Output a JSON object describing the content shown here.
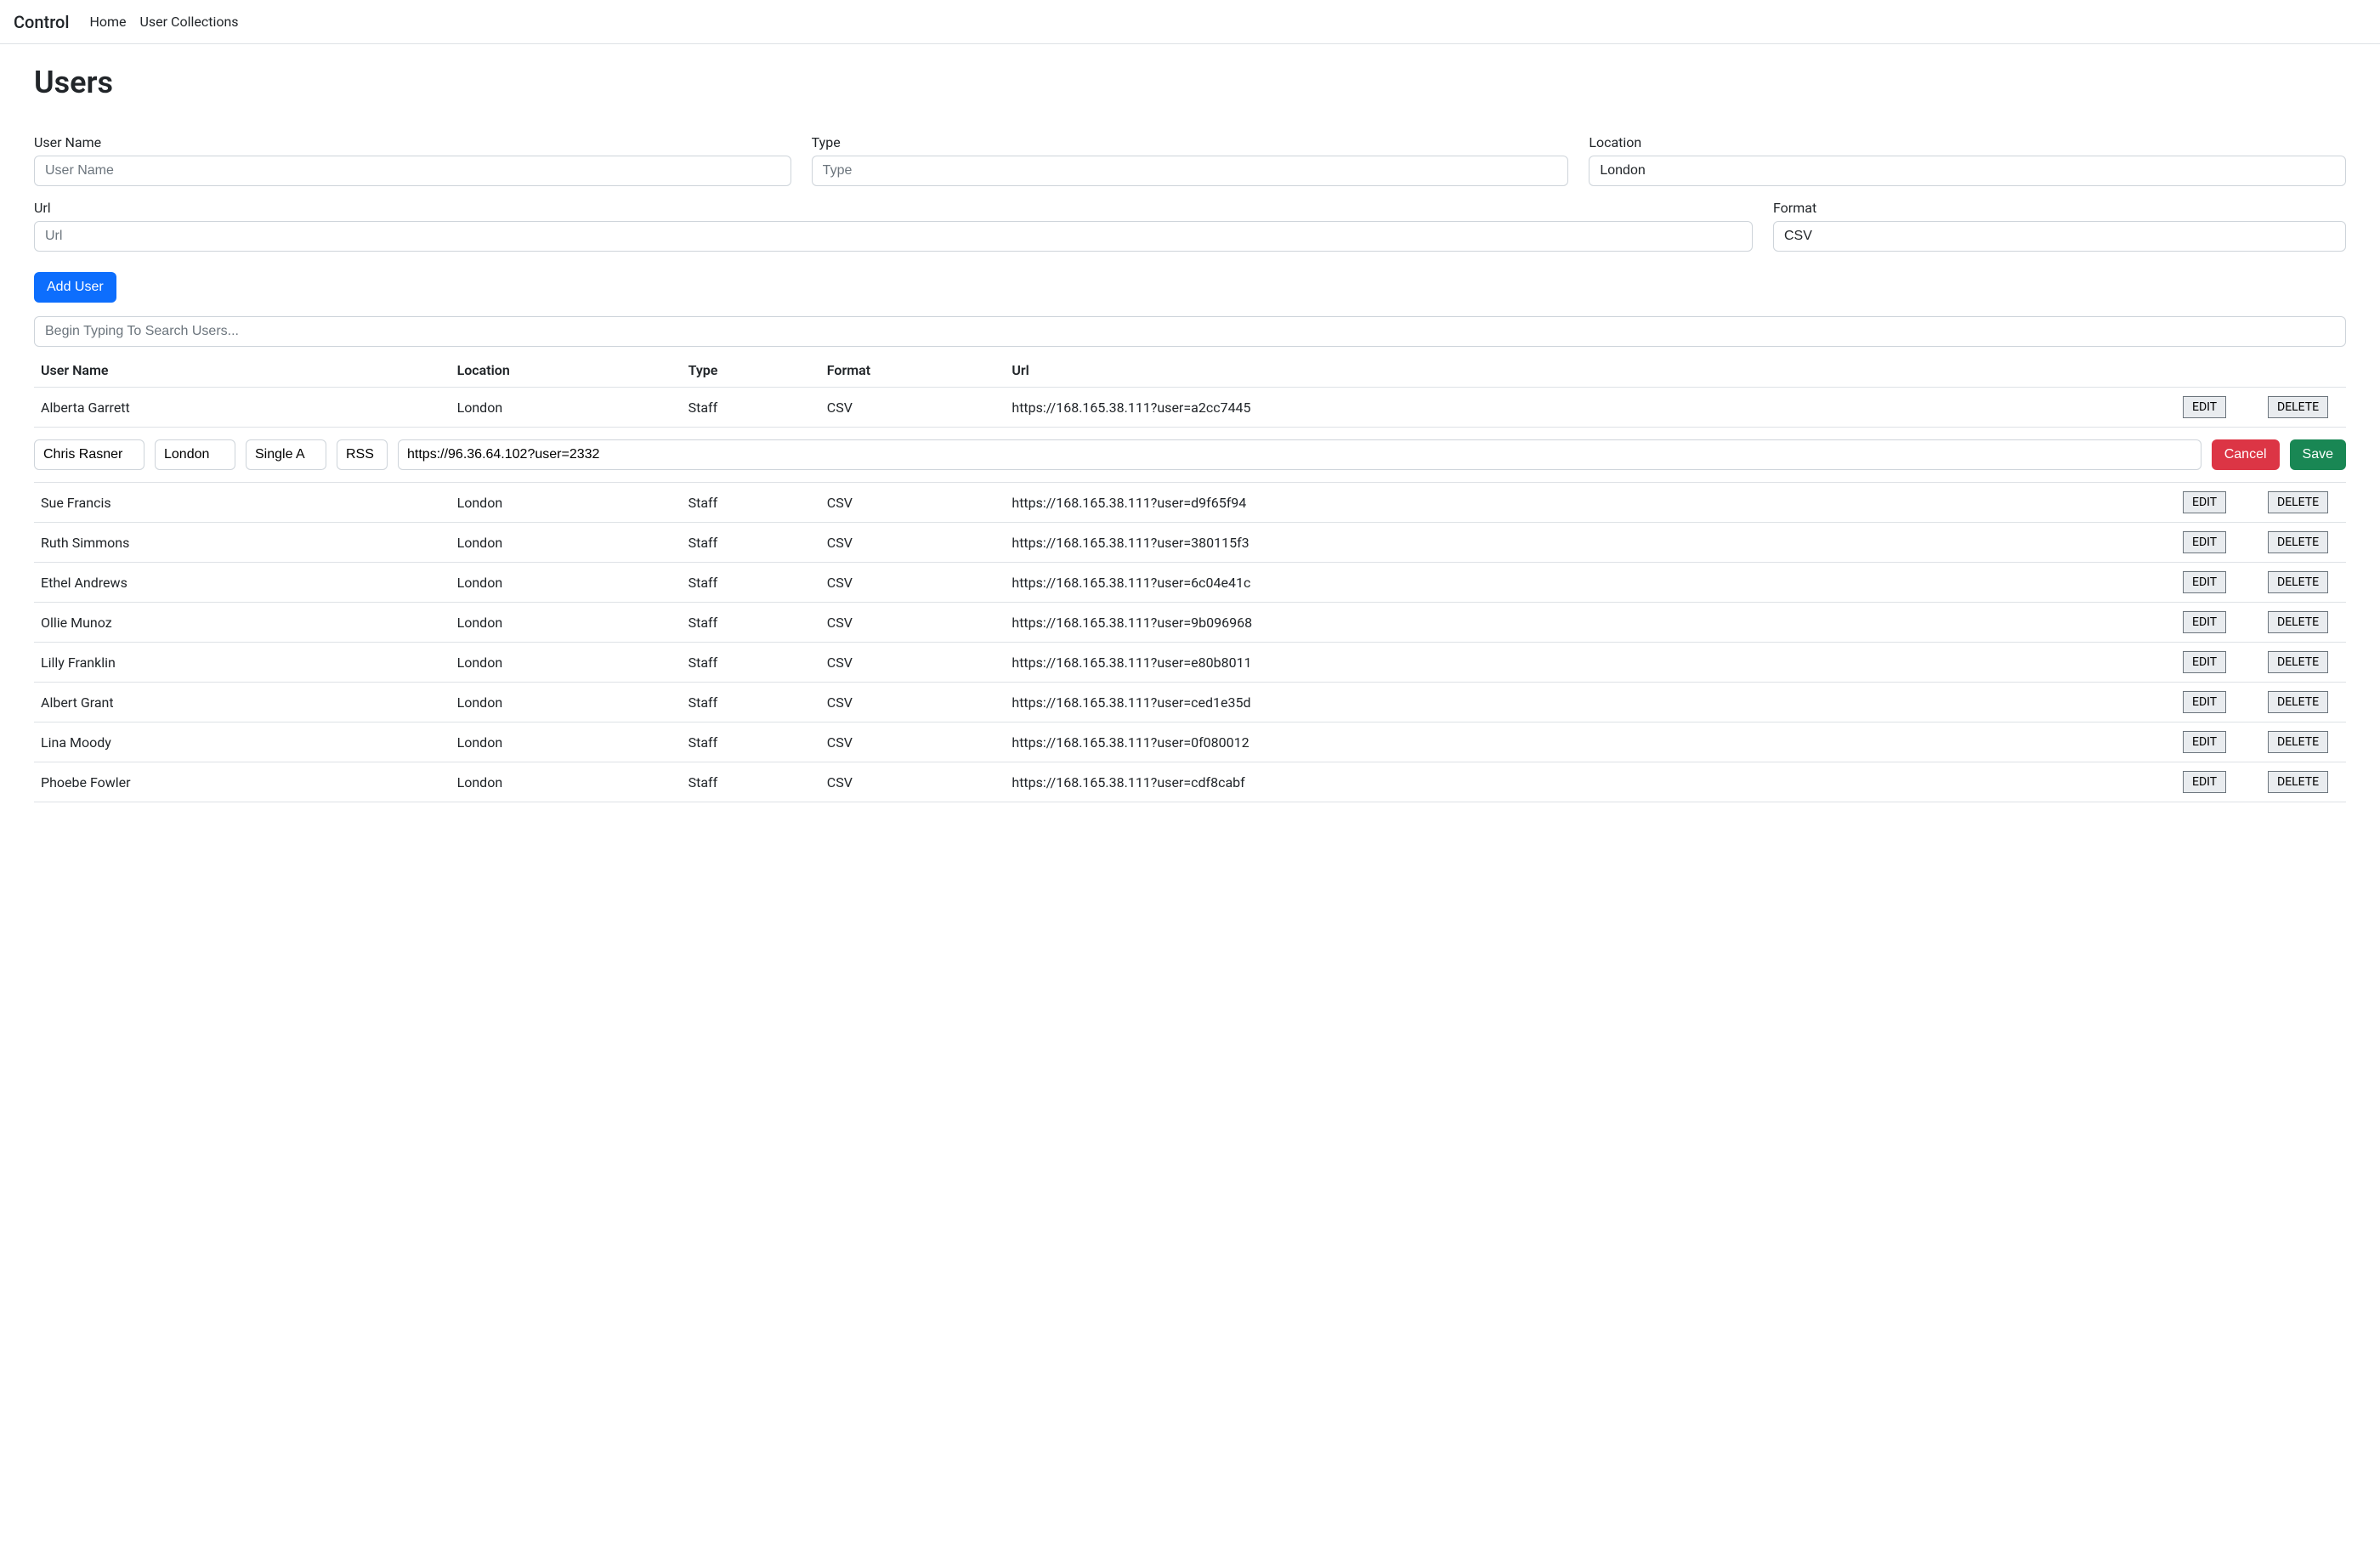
{
  "nav": {
    "brand": "Control",
    "links": [
      "Home",
      "User Collections"
    ]
  },
  "page_title": "Users",
  "form": {
    "username_label": "User Name",
    "username_placeholder": "User Name",
    "username_value": "",
    "type_label": "Type",
    "type_placeholder": "Type",
    "type_value": "",
    "location_label": "Location",
    "location_placeholder": "Location",
    "location_value": "London",
    "url_label": "Url",
    "url_placeholder": "Url",
    "url_value": "",
    "format_label": "Format",
    "format_placeholder": "Format",
    "format_value": "CSV",
    "add_button": "Add User"
  },
  "search": {
    "placeholder": "Begin Typing To Search Users...",
    "value": ""
  },
  "table": {
    "headers": {
      "username": "User Name",
      "location": "Location",
      "type": "Type",
      "format": "Format",
      "url": "Url"
    },
    "edit_label": "EDIT",
    "delete_label": "DELETE",
    "cancel_label": "Cancel",
    "save_label": "Save",
    "rows": [
      {
        "username": "Alberta Garrett",
        "location": "London",
        "type": "Staff",
        "format": "CSV",
        "url": "https://168.165.38.111?user=a2cc7445"
      },
      {
        "editing": true,
        "username": "Chris Rasner",
        "location": "London",
        "type": "Single A",
        "format": "RSS",
        "url": "https://96.36.64.102?user=2332"
      },
      {
        "username": "Sue Francis",
        "location": "London",
        "type": "Staff",
        "format": "CSV",
        "url": "https://168.165.38.111?user=d9f65f94"
      },
      {
        "username": "Ruth Simmons",
        "location": "London",
        "type": "Staff",
        "format": "CSV",
        "url": "https://168.165.38.111?user=380115f3"
      },
      {
        "username": "Ethel Andrews",
        "location": "London",
        "type": "Staff",
        "format": "CSV",
        "url": "https://168.165.38.111?user=6c04e41c"
      },
      {
        "username": "Ollie Munoz",
        "location": "London",
        "type": "Staff",
        "format": "CSV",
        "url": "https://168.165.38.111?user=9b096968"
      },
      {
        "username": "Lilly Franklin",
        "location": "London",
        "type": "Staff",
        "format": "CSV",
        "url": "https://168.165.38.111?user=e80b8011"
      },
      {
        "username": "Albert Grant",
        "location": "London",
        "type": "Staff",
        "format": "CSV",
        "url": "https://168.165.38.111?user=ced1e35d"
      },
      {
        "username": "Lina Moody",
        "location": "London",
        "type": "Staff",
        "format": "CSV",
        "url": "https://168.165.38.111?user=0f080012"
      },
      {
        "username": "Phoebe Fowler",
        "location": "London",
        "type": "Staff",
        "format": "CSV",
        "url": "https://168.165.38.111?user=cdf8cabf"
      }
    ]
  }
}
